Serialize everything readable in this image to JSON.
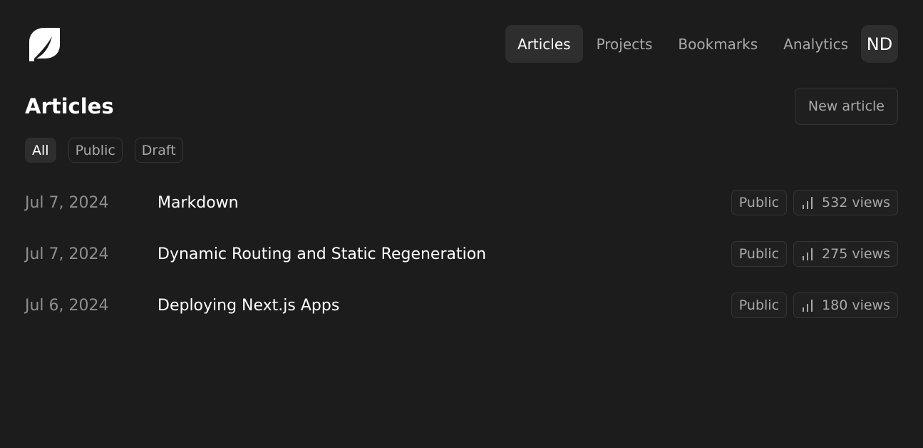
{
  "header": {
    "logo_icon": "leaf-icon",
    "nav": [
      {
        "label": "Articles",
        "active": true
      },
      {
        "label": "Projects",
        "active": false
      },
      {
        "label": "Bookmarks",
        "active": false
      },
      {
        "label": "Analytics",
        "active": false
      }
    ],
    "avatar_initials": "ND"
  },
  "page": {
    "title": "Articles",
    "new_button_label": "New article"
  },
  "filters": [
    {
      "label": "All",
      "active": true
    },
    {
      "label": "Public",
      "active": false
    },
    {
      "label": "Draft",
      "active": false
    }
  ],
  "articles": [
    {
      "date": "Jul 7, 2024",
      "title": "Markdown",
      "visibility": "Public",
      "views": "532 views"
    },
    {
      "date": "Jul 7, 2024",
      "title": "Dynamic Routing and Static Regeneration",
      "visibility": "Public",
      "views": "275 views"
    },
    {
      "date": "Jul 6, 2024",
      "title": "Deploying Next.js Apps",
      "visibility": "Public",
      "views": "180 views"
    }
  ],
  "icons": {
    "views_icon": "bar-chart-icon"
  },
  "colors": {
    "background": "#1c1c1c",
    "active_bg": "#2e2e2e",
    "muted_text": "#a9a9a9",
    "date_text": "#8f8f8f",
    "border": "#353535"
  }
}
